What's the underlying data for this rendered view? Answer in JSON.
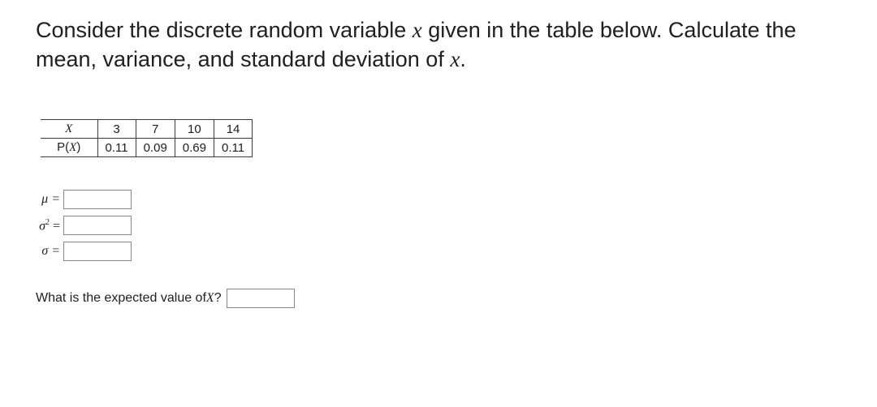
{
  "prompt": {
    "part1": "Consider the discrete random variable ",
    "xvar": "x",
    "part2": " given in the table below. Calculate the mean, variance, and standard deviation of ",
    "xvar2": "x",
    "part3": "."
  },
  "table": {
    "row1_header": "X",
    "row1": [
      "3",
      "7",
      "10",
      "14"
    ],
    "row2_header_plain1": "P(",
    "row2_header_ital": "X",
    "row2_header_plain2": ")",
    "row2": [
      "0.11",
      "0.09",
      "0.69",
      "0.11"
    ]
  },
  "answers": {
    "mu_label": "μ =",
    "sigma2_label_base": "σ",
    "sigma2_label_sup": "2",
    "sigma2_label_eq": " =",
    "sigma_label": "σ =",
    "mu_val": "",
    "sigma2_val": "",
    "sigma_val": ""
  },
  "expected": {
    "text1": "What is the expected value of ",
    "xvar": "X",
    "text2": "?",
    "val": ""
  }
}
